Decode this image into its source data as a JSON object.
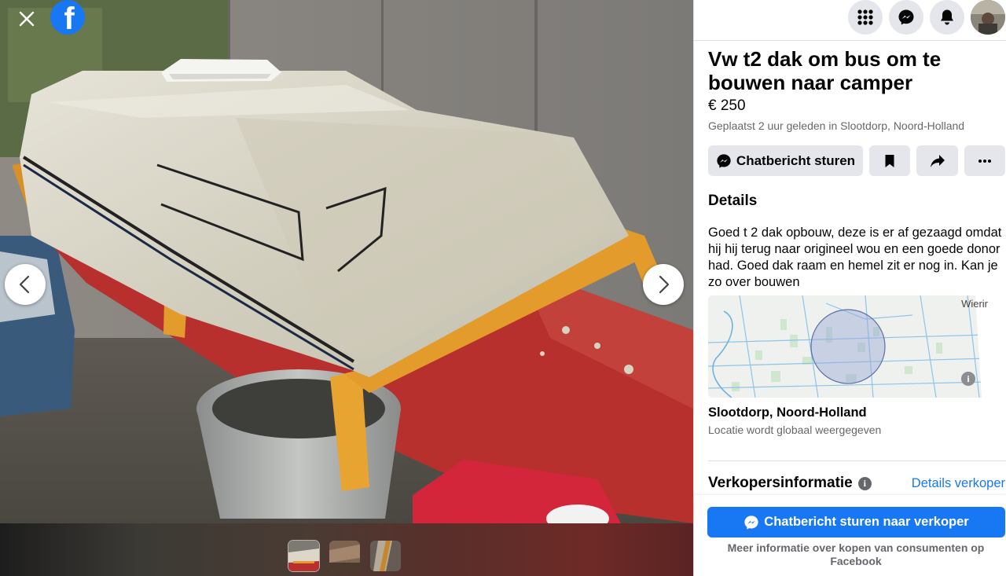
{
  "viewer": {
    "photo_count": 3,
    "current_index": 0
  },
  "listing": {
    "title": "Vw t2 dak om bus om te bouwen naar camper",
    "price": "€ 250",
    "meta": "Geplaatst 2 uur geleden in Slootdorp, Noord-Holland",
    "actions": {
      "chat_label": "Chatbericht sturen"
    },
    "details_heading": "Details",
    "description": "Goed t 2 dak opbouw, deze is er af gezaagd omdat hij hij terug naar origineel wou en een goede donor had. Goed dak raam en hemel zit er nog in. Kan je zo over bouwen",
    "map": {
      "label": "Wierir",
      "info_glyph": "i"
    },
    "location_name": "Slootdorp, Noord-Holland",
    "location_note": "Locatie wordt globaal weergegeven"
  },
  "seller": {
    "heading": "Verkopersinformatie",
    "info_glyph": "i",
    "details_link": "Details verkoper"
  },
  "footer": {
    "cta_label": "Chatbericht sturen naar verkoper",
    "note": "Meer informatie over kopen van consumenten op Facebook"
  },
  "icons": {
    "close": "close-icon",
    "facebook": "facebook-logo",
    "prev": "chevron-left-icon",
    "next": "chevron-right-icon",
    "menu": "grid-menu-icon",
    "messenger": "messenger-icon",
    "notifications": "bell-icon",
    "save": "bookmark-icon",
    "share": "share-arrow-icon",
    "more": "more-dots-icon"
  },
  "colors": {
    "brand": "#1877f2",
    "button_gray": "#e4e6eb",
    "secondary_text": "#65676b"
  }
}
